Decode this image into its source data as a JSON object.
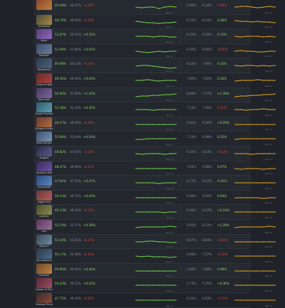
{
  "rows": [
    {
      "hero": "",
      "c": [
        "#8b4a2c",
        "#c07b3e"
      ],
      "v1": "45.49%",
      "v2": "48.67%",
      "d1": "-3.18%",
      "d1c": "neg",
      "v3": "6.96%",
      "v4": "6.34%",
      "d2": "0.64%",
      "d2c": "neg",
      "g": [
        10,
        11,
        10,
        10,
        12,
        10,
        9,
        10
      ],
      "o": [
        10,
        9,
        9,
        10,
        11,
        10,
        9,
        10
      ],
      "lab": "May 31"
    },
    {
      "hero": "Alchemist",
      "c": [
        "#4e4b3a",
        "#a38b46"
      ],
      "v1": "48.76%",
      "v2": "49.00%",
      "d1": "-0.24%",
      "d1c": "neg",
      "v3": "8.72%",
      "v4": "8.34%",
      "d2": "0.38%",
      "d2c": "pos",
      "g": [
        9,
        10,
        11,
        11,
        12,
        11,
        11,
        10
      ],
      "o": [
        8,
        9,
        9,
        10,
        9,
        10,
        10,
        11
      ],
      "lab": "May 31"
    },
    {
      "hero": "Bane",
      "c": [
        "#5a3d7a",
        "#8d66b5"
      ],
      "v1": "52.87%",
      "v2": "52.55%",
      "d1": "+0.32%",
      "d1c": "pos",
      "v3": "8.31%",
      "v4": "8.20%",
      "d2": "0.11%",
      "d2c": "pos",
      "g": [
        10,
        10,
        10,
        11,
        10,
        10,
        11,
        11
      ],
      "o": [
        10,
        11,
        10,
        10,
        10,
        11,
        10,
        11
      ],
      "lab": "May 31"
    },
    {
      "hero": "Batrider",
      "c": [
        "#3c4b6a",
        "#6b7e9c"
      ],
      "v1": "51.98%",
      "v2": "51.96%",
      "d1": "+0.02%",
      "d1c": "pos",
      "v3": "8.35%",
      "v4": "8.40%",
      "d2": "-0.05%",
      "d2c": "neg",
      "g": [
        10,
        11,
        12,
        11,
        10,
        11,
        10,
        10
      ],
      "o": [
        10,
        9,
        10,
        10,
        11,
        11,
        10,
        10
      ],
      "lab": "May 31"
    },
    {
      "hero": "Bristleback",
      "c": [
        "#2d3d52",
        "#4a6078"
      ],
      "v1": "49.98%",
      "v2": "50.23%",
      "d1": "-0.25%",
      "d1c": "neg",
      "v3": "8.22%",
      "v4": "7.90%",
      "d2": "0.32%",
      "d2c": "pos",
      "g": [
        11,
        10,
        10,
        11,
        12,
        13,
        14,
        13
      ],
      "o": [
        10,
        11,
        10,
        10,
        11,
        10,
        11,
        10
      ],
      "lab": "May 31"
    },
    {
      "hero": "Chaos Knight",
      "c": [
        "#6a2a2a",
        "#a64040"
      ],
      "v1": "48.50%",
      "v2": "48.46%",
      "d1": "+0.04%",
      "d1c": "pos",
      "v3": "7.80%",
      "v4": "7.60%",
      "d2": "0.20%",
      "d2c": "pos",
      "g": [
        10,
        10,
        9,
        10,
        11,
        10,
        10,
        10
      ],
      "o": [
        11,
        10,
        10,
        10,
        9,
        10,
        10,
        10
      ],
      "lab": "May 31"
    },
    {
      "hero": "Dark Seer",
      "c": [
        "#4a3a62",
        "#7a65a0"
      ],
      "v1": "50.96%",
      "v2": "51.69%",
      "d1": "+1.42%",
      "d1c": "pos",
      "v3": "8.80%",
      "v4": "7.37%",
      "d2": "+1.38%",
      "d2c": "pos",
      "g": [
        12,
        11,
        11,
        10,
        10,
        9,
        9,
        8
      ],
      "o": [
        12,
        11,
        11,
        10,
        10,
        9,
        9,
        8
      ],
      "lab": "May 31"
    },
    {
      "hero": "Death Prophet",
      "c": [
        "#2e5a6a",
        "#5ea0b2"
      ],
      "v1": "52.38%",
      "v2": "52.43%",
      "d1": "+0.35%",
      "d1c": "pos",
      "v3": "7.15%",
      "v4": "7.26%",
      "d2": "0.11%",
      "d2c": "neg",
      "g": [
        10,
        10,
        10,
        11,
        10,
        10,
        10,
        10
      ],
      "o": [
        10,
        10,
        11,
        10,
        10,
        9,
        10,
        10
      ],
      "lab": "May 31"
    },
    {
      "hero": "Dragon Knight",
      "c": [
        "#6a3a2a",
        "#b06a44"
      ],
      "v1": "48.27%",
      "v2": "48.56%",
      "d1": "-0.29%",
      "d1c": "neg",
      "v3": "6.91%",
      "v4": "6.56%",
      "d2": "+0.09%",
      "d2c": "pos",
      "g": [
        10,
        10,
        10,
        10,
        10,
        10,
        10,
        10
      ],
      "o": [
        10,
        10,
        10,
        10,
        10,
        10,
        10,
        10
      ],
      "lab": "May 31"
    },
    {
      "hero": "Drow Ranger",
      "c": [
        "#3a4e6a",
        "#7a95b8"
      ],
      "v1": "53.98%",
      "v2": "53.44%",
      "d1": "+0.54%",
      "d1c": "pos",
      "v3": "7.23%",
      "v4": "6.98%",
      "d2": "0.25%",
      "d2c": "pos",
      "g": [
        11,
        11,
        10,
        10,
        10,
        10,
        10,
        10
      ],
      "o": [
        11,
        10,
        10,
        10,
        10,
        10,
        10,
        10
      ],
      "lab": "May 31"
    },
    {
      "hero": "Enigma",
      "c": [
        "#2a2a4a",
        "#5a5a8a"
      ],
      "v1": "46.82%",
      "v2": "47.92%",
      "d1": "-1.10%",
      "d1c": "neg",
      "v3": "6.31%",
      "v4": "6.43%",
      "d2": "-0.12%",
      "d2c": "neg",
      "g": [
        10,
        11,
        10,
        10,
        10,
        11,
        10,
        10
      ],
      "o": [
        10,
        10,
        10,
        11,
        10,
        10,
        10,
        10
      ],
      "lab": "May 31"
    },
    {
      "hero": "Faceless Void",
      "c": [
        "#3a2a5a",
        "#6a50a0"
      ],
      "v1": "48.47%",
      "v2": "48.98%",
      "d1": "-0.51%",
      "d1c": "neg",
      "v3": "7.05%",
      "v4": "6.98%",
      "d2": "0.07%",
      "d2c": "pos",
      "g": [
        10,
        10,
        10,
        10,
        10,
        10,
        10,
        10
      ],
      "o": [
        10,
        11,
        10,
        10,
        10,
        11,
        10,
        10
      ],
      "lab": "May 31"
    },
    {
      "hero": "Gyrocopter",
      "c": [
        "#2a4a7a",
        "#5a85c0"
      ],
      "v1": "47.82%",
      "v2": "47.35%",
      "d1": "+0.47%",
      "d1c": "pos",
      "v3": "6.77%",
      "v4": "6.57%",
      "d2": "0.20%",
      "d2c": "pos",
      "g": [
        10,
        10,
        10,
        10,
        11,
        10,
        10,
        10
      ],
      "o": [
        10,
        10,
        10,
        10,
        10,
        10,
        10,
        10
      ],
      "lab": "May 31"
    },
    {
      "hero": "Juggernaut",
      "c": [
        "#6a3a3a",
        "#b25a5a"
      ],
      "v1": "50.14%",
      "v2": "49.71%",
      "d1": "+0.43%",
      "d1c": "pos",
      "v3": "6.96%",
      "v4": "6.92%",
      "d2": "0.04%",
      "d2c": "pos",
      "g": [
        10,
        10,
        10,
        10,
        10,
        10,
        10,
        10
      ],
      "o": [
        10,
        10,
        10,
        10,
        10,
        11,
        10,
        10
      ],
      "lab": "May 31"
    },
    {
      "hero": "Leshrac",
      "c": [
        "#4a4a2a",
        "#8a8a50"
      ],
      "v1": "48.13%",
      "v2": "48.30%",
      "d1": "-0.17%",
      "d1c": "neg",
      "v3": "6.90%",
      "v4": "6.67%",
      "d2": "+0.24%",
      "d2c": "pos",
      "g": [
        10,
        10,
        10,
        10,
        10,
        11,
        10,
        10
      ],
      "o": [
        10,
        10,
        10,
        10,
        10,
        10,
        10,
        10
      ],
      "lab": "May 31"
    },
    {
      "hero": "Lion",
      "c": [
        "#5a3a5a",
        "#9a6a9a"
      ],
      "v1": "52.19%",
      "v2": "53.57%",
      "d1": "+0.38%",
      "d1c": "pos",
      "v3": "8.85%",
      "v4": "8.33%",
      "d2": "+1.28%",
      "d2c": "pos",
      "g": [
        11,
        10,
        10,
        10,
        10,
        10,
        9,
        10
      ],
      "o": [
        11,
        10,
        10,
        10,
        10,
        10,
        9,
        10
      ],
      "lab": "May 31"
    },
    {
      "hero": "Magnus",
      "c": [
        "#3a4a5a",
        "#6a8aa0"
      ],
      "v1": "51.44%",
      "v2": "51.81%",
      "d1": "-0.37%",
      "d1c": "neg",
      "v3": "8.47%",
      "v4": "8.84%",
      "d2": "-0.44%",
      "d2c": "neg",
      "g": [
        10,
        10,
        9,
        9,
        10,
        10,
        11,
        11
      ],
      "o": [
        10,
        10,
        10,
        10,
        10,
        10,
        10,
        10
      ],
      "lab": "May 31"
    },
    {
      "hero": "Nyx Assassin",
      "c": [
        "#2a3a4a",
        "#4a6a8a"
      ],
      "v1": "50.17%",
      "v2": "50.48%",
      "d1": "-0.31%",
      "d1c": "neg",
      "v3": "6.95%",
      "v4": "7.37%",
      "d2": "-0.42%",
      "d2c": "neg",
      "g": [
        10,
        11,
        10,
        11,
        11,
        11,
        12,
        11
      ],
      "o": [
        10,
        10,
        10,
        10,
        10,
        10,
        10,
        10
      ],
      "lab": "May 31"
    },
    {
      "hero": "Phoenix",
      "c": [
        "#6a4a2a",
        "#c08040"
      ],
      "v1": "49.86%",
      "v2": "49.40%",
      "d1": "+0.46%",
      "d1c": "pos",
      "v3": "3.96%",
      "v4": "3.88%",
      "d2": "0.08%",
      "d2c": "pos",
      "g": [
        10,
        10,
        10,
        10,
        10,
        10,
        10,
        10
      ],
      "o": [
        10,
        10,
        10,
        10,
        10,
        10,
        10,
        10
      ],
      "lab": "May 31"
    },
    {
      "hero": "Queen of Pain",
      "c": [
        "#5a2a3a",
        "#a04a60"
      ],
      "v1": "50.43%",
      "v2": "50.11%",
      "d1": "+0.32%",
      "d1c": "pos",
      "v3": "5.72%",
      "v4": "5.35%",
      "d2": "+0.36%",
      "d2c": "pos",
      "g": [
        10,
        10,
        10,
        10,
        10,
        10,
        10,
        10
      ],
      "o": [
        10,
        10,
        10,
        10,
        10,
        10,
        10,
        10
      ],
      "lab": "May 31"
    },
    {
      "hero": "Shadow Fiend",
      "c": [
        "#3a2a2a",
        "#8a4a3a"
      ],
      "v1": "47.75%",
      "v2": "48.30%",
      "d1": "-0.55%",
      "d1c": "neg",
      "v3": "6.32%",
      "v4": "6.83%",
      "d2": "-0.51%",
      "d2c": "neg",
      "g": [
        10,
        10,
        10,
        10,
        10,
        10,
        10,
        10
      ],
      "o": [
        10,
        10,
        10,
        10,
        10,
        10,
        10,
        10
      ],
      "lab": "May 31"
    }
  ]
}
